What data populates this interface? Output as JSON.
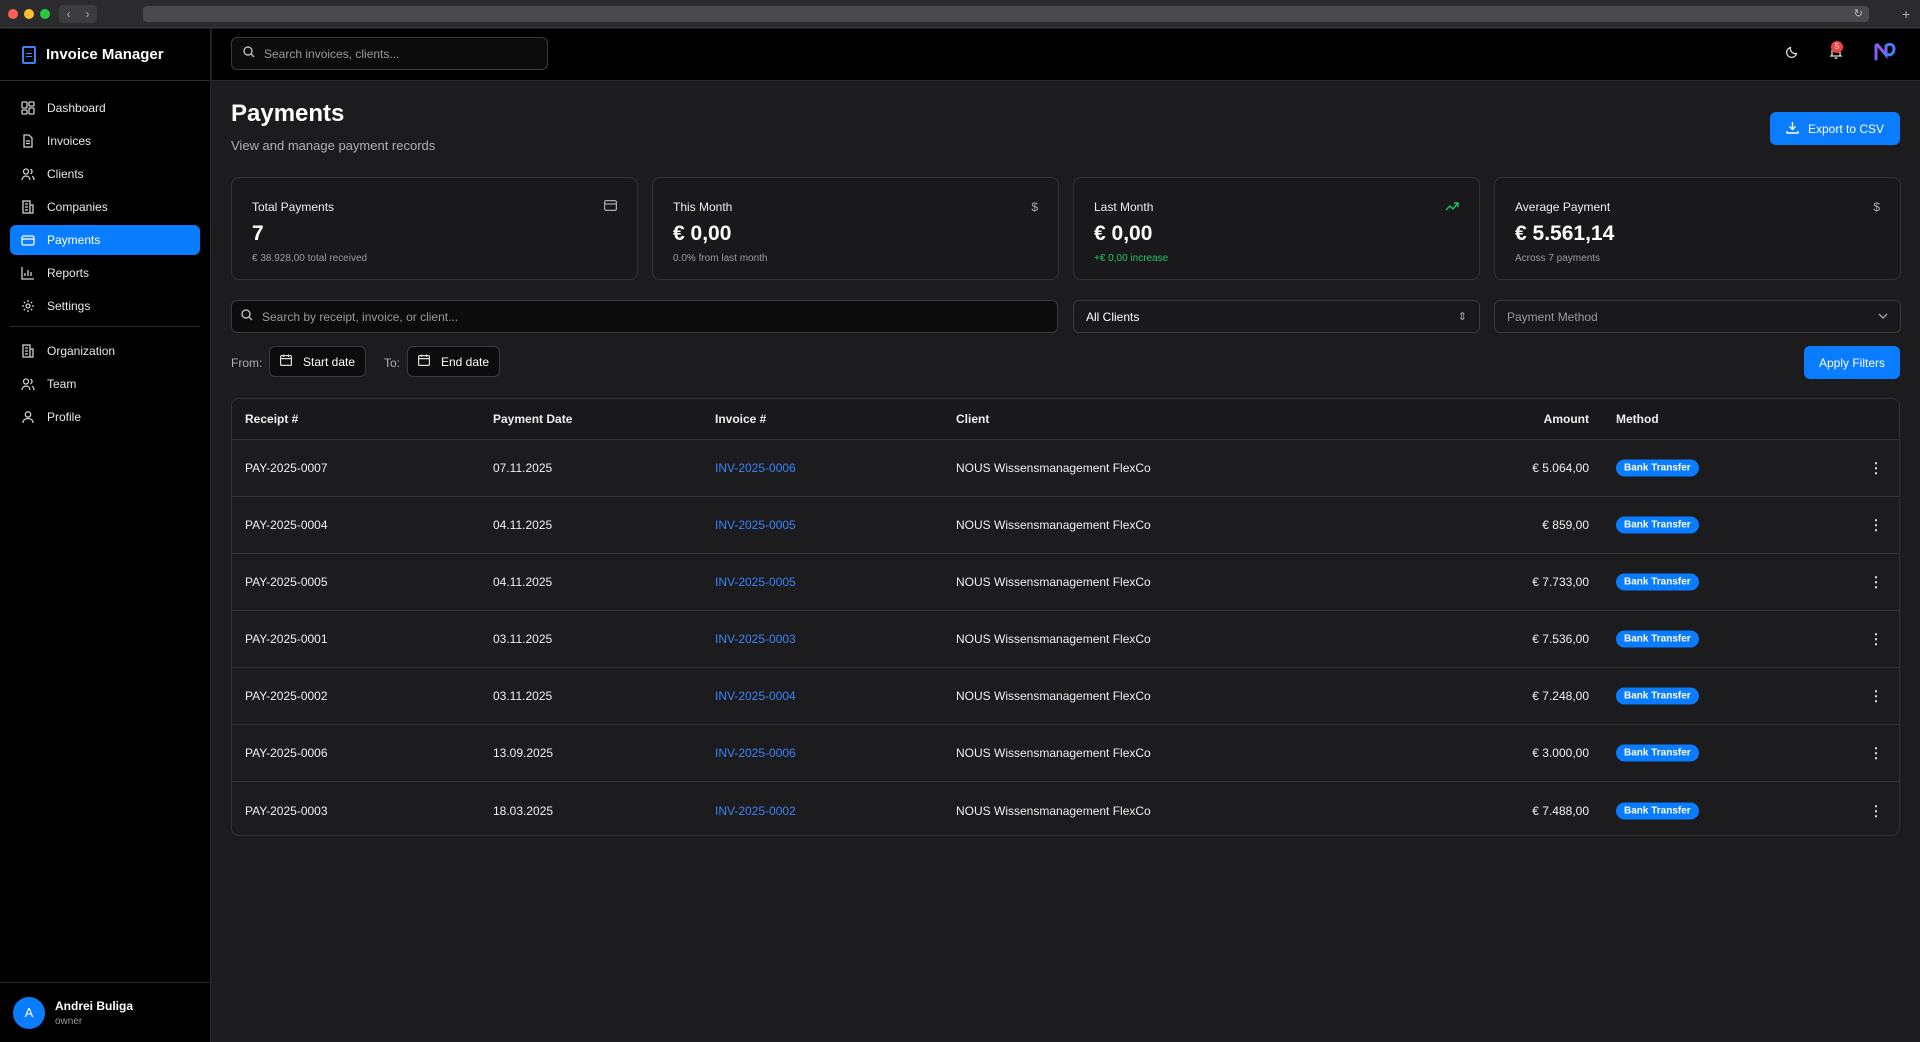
{
  "app": {
    "name": "Invoice Manager"
  },
  "global_search": {
    "placeholder": "Search invoices, clients..."
  },
  "notifications": {
    "count": "5"
  },
  "sidebar": {
    "items": [
      {
        "label": "Dashboard",
        "icon": "grid-icon"
      },
      {
        "label": "Invoices",
        "icon": "file-icon"
      },
      {
        "label": "Clients",
        "icon": "users-icon"
      },
      {
        "label": "Companies",
        "icon": "building-icon"
      },
      {
        "label": "Payments",
        "icon": "credit-card-icon",
        "active": true
      },
      {
        "label": "Reports",
        "icon": "bar-chart-icon"
      },
      {
        "label": "Settings",
        "icon": "gear-icon"
      }
    ],
    "secondary": [
      {
        "label": "Organization",
        "icon": "building-icon"
      },
      {
        "label": "Team",
        "icon": "users-icon"
      },
      {
        "label": "Profile",
        "icon": "user-icon"
      }
    ],
    "user": {
      "initial": "A",
      "name": "Andrei Buliga",
      "role": "owner"
    }
  },
  "page": {
    "title": "Payments",
    "subtitle": "View and manage payment records",
    "export_label": "Export to CSV"
  },
  "stats": [
    {
      "title": "Total Payments",
      "value": "7",
      "sub": "€ 38.928,00 total received",
      "icon": "credit-card-icon"
    },
    {
      "title": "This Month",
      "value": "€ 0,00",
      "sub": "0.0% from last month",
      "icon": "dollar-icon"
    },
    {
      "title": "Last Month",
      "value": "€ 0,00",
      "sub": "+€ 0,00 increase",
      "icon": "trending-up-icon",
      "accent": "#22c55e"
    },
    {
      "title": "Average Payment",
      "value": "€ 5.561,14",
      "sub": "Across 7 payments",
      "icon": "dollar-icon"
    }
  ],
  "filters": {
    "search_placeholder": "Search by receipt, invoice, or client...",
    "client_select": "All Clients",
    "method_select": "Payment Method",
    "from_label": "From:",
    "to_label": "To:",
    "start_date": "Start date",
    "end_date": "End date",
    "apply_label": "Apply Filters"
  },
  "table": {
    "headers": {
      "receipt": "Receipt #",
      "date": "Payment Date",
      "invoice": "Invoice #",
      "client": "Client",
      "amount": "Amount",
      "method": "Method"
    },
    "rows": [
      {
        "receipt": "PAY-2025-0007",
        "date": "07.11.2025",
        "invoice": "INV-2025-0006",
        "client": "NOUS Wissensmanagement FlexCo",
        "amount": "€ 5.064,00",
        "method": "Bank Transfer"
      },
      {
        "receipt": "PAY-2025-0004",
        "date": "04.11.2025",
        "invoice": "INV-2025-0005",
        "client": "NOUS Wissensmanagement FlexCo",
        "amount": "€ 859,00",
        "method": "Bank Transfer"
      },
      {
        "receipt": "PAY-2025-0005",
        "date": "04.11.2025",
        "invoice": "INV-2025-0005",
        "client": "NOUS Wissensmanagement FlexCo",
        "amount": "€ 7.733,00",
        "method": "Bank Transfer"
      },
      {
        "receipt": "PAY-2025-0001",
        "date": "03.11.2025",
        "invoice": "INV-2025-0003",
        "client": "NOUS Wissensmanagement FlexCo",
        "amount": "€ 7.536,00",
        "method": "Bank Transfer"
      },
      {
        "receipt": "PAY-2025-0002",
        "date": "03.11.2025",
        "invoice": "INV-2025-0004",
        "client": "NOUS Wissensmanagement FlexCo",
        "amount": "€ 7.248,00",
        "method": "Bank Transfer"
      },
      {
        "receipt": "PAY-2025-0006",
        "date": "13.09.2025",
        "invoice": "INV-2025-0006",
        "client": "NOUS Wissensmanagement FlexCo",
        "amount": "€ 3.000,00",
        "method": "Bank Transfer"
      },
      {
        "receipt": "PAY-2025-0003",
        "date": "18.03.2025",
        "invoice": "INV-2025-0002",
        "client": "NOUS Wissensmanagement FlexCo",
        "amount": "€ 7.488,00",
        "method": "Bank Transfer"
      }
    ]
  },
  "colors": {
    "accent": "#0a7cff",
    "link": "#3b82f6",
    "positive": "#22c55e",
    "background": "#1c1c1e"
  }
}
